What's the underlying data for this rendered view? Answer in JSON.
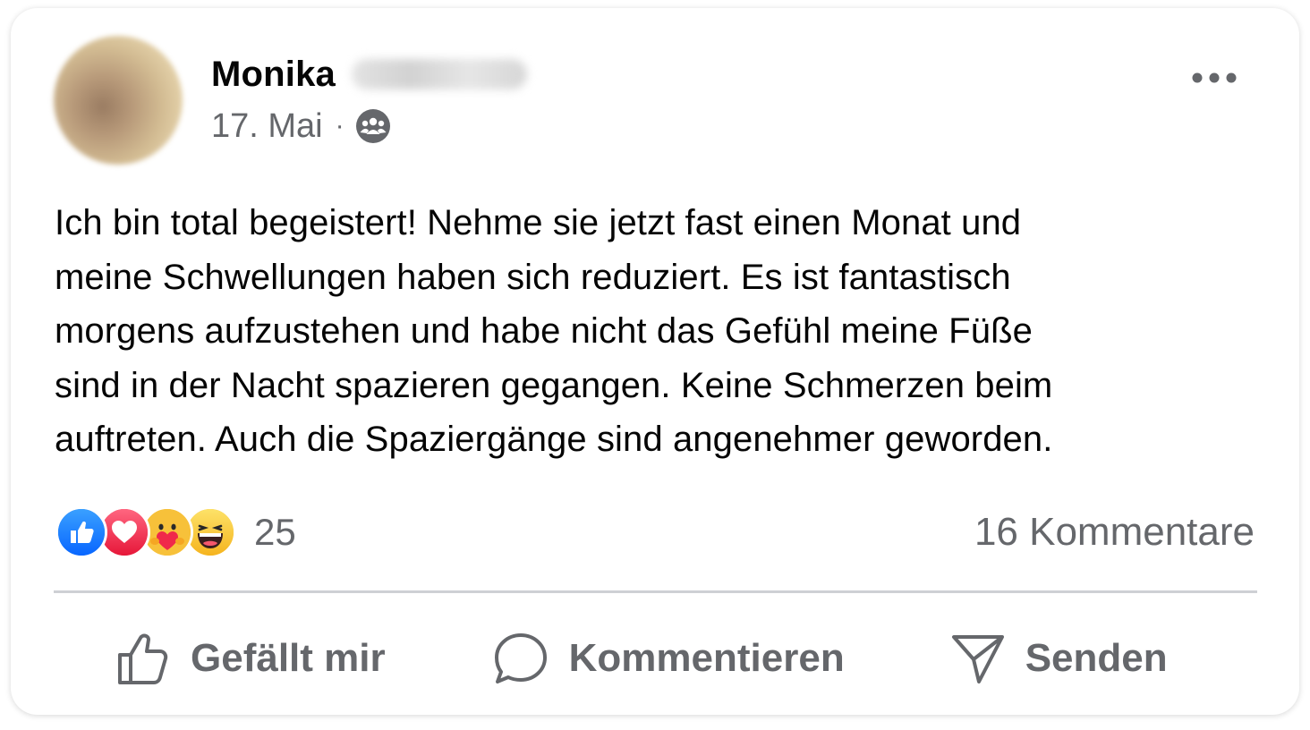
{
  "post": {
    "author_first_name": "Monika",
    "date": "17. Mai",
    "separator": "·",
    "audience_icon": "friends-icon",
    "more_icon": "more-horizontal-icon",
    "text": "Ich bin total begeistert! Nehme sie jetzt fast einen Monat und\nmeine Schwellungen haben sich reduziert. Es ist fantastisch\nmorgens aufzustehen und habe nicht das Gefühl meine Füße\nsind in der Nacht spazieren gegangen. Keine Schmerzen beim\nauftreten. Auch die Spaziergänge sind angenehmer geworden."
  },
  "reactions": {
    "icons": [
      "like-reaction-icon",
      "love-reaction-icon",
      "care-reaction-icon",
      "haha-reaction-icon"
    ],
    "count": "25",
    "comments_label": "16 Kommentare"
  },
  "actions": {
    "like_label": "Gefällt mir",
    "comment_label": "Kommentieren",
    "send_label": "Senden"
  },
  "colors": {
    "text_primary": "#050505",
    "text_secondary": "#65676b",
    "like_blue": "#1877f2",
    "love_red": "#f33e58",
    "emoji_yellow": "#f7b928",
    "divider": "#ced0d4"
  }
}
